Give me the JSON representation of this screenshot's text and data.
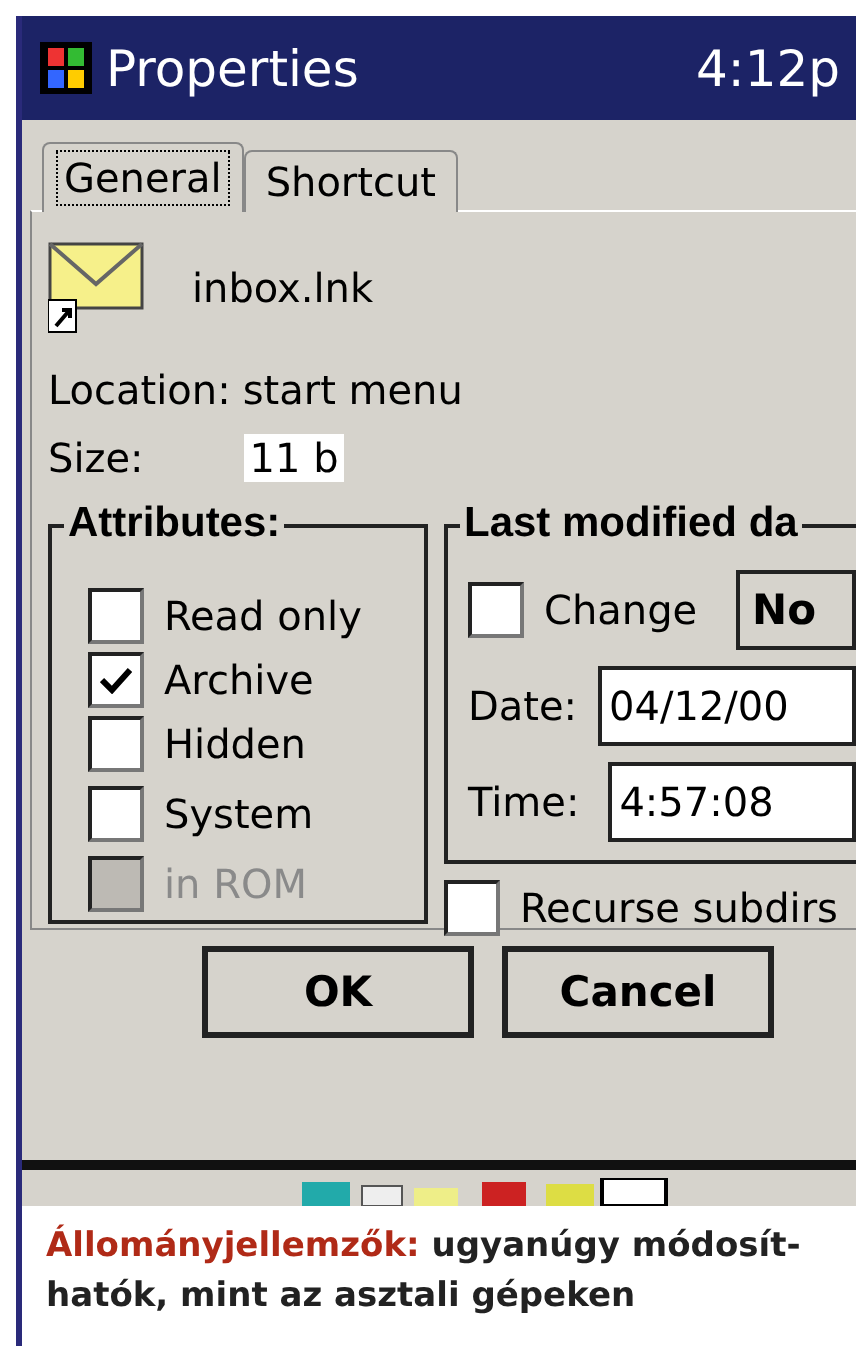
{
  "window": {
    "title": "Properties",
    "clock": "4:12p"
  },
  "tabs": [
    {
      "label": "General",
      "selected": true
    },
    {
      "label": "Shortcut",
      "selected": false
    }
  ],
  "file": {
    "name": "inbox.lnk",
    "location_label": "Location:",
    "location": "start menu",
    "size_label": "Size:",
    "size": "11 b"
  },
  "attributes": {
    "title": "Attributes:",
    "items": [
      {
        "label": "Read only",
        "checked": false,
        "disabled": false
      },
      {
        "label": "Archive",
        "checked": true,
        "disabled": false
      },
      {
        "label": "Hidden",
        "checked": false,
        "disabled": false
      },
      {
        "label": "System",
        "checked": false,
        "disabled": false
      },
      {
        "label": "in ROM",
        "checked": false,
        "disabled": true
      }
    ]
  },
  "modified": {
    "title": "Last modified da",
    "change": {
      "label": "Change",
      "checked": false
    },
    "now_button": "No",
    "date_label": "Date:",
    "date": "04/12/00",
    "time_label": "Time:",
    "time": "4:57:08"
  },
  "recurse": {
    "label": "Recurse subdirs",
    "checked": false
  },
  "buttons": [
    "OK",
    "Cancel"
  ],
  "caption": {
    "lead": "Állományjellemzők:",
    "text": "ugyanúgy módosít-hatók, mint az asztali gépeken"
  }
}
